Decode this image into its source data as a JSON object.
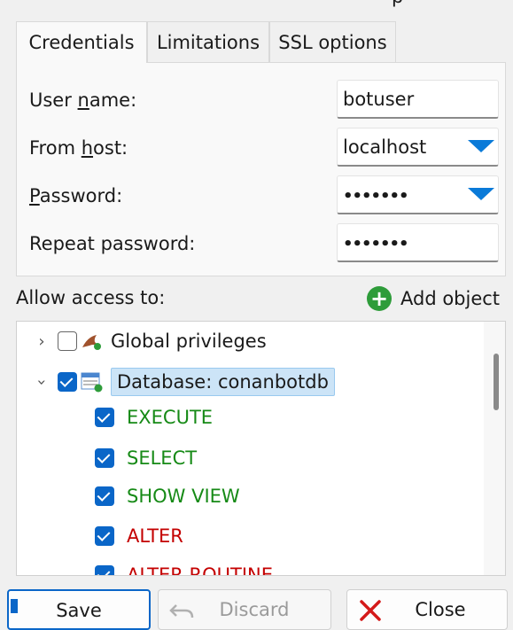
{
  "top_fragment": "p",
  "tabs": [
    {
      "label": "Credentials",
      "active": true
    },
    {
      "label": "Limitations",
      "active": false
    },
    {
      "label": "SSL options",
      "active": false
    }
  ],
  "fields": {
    "user_name": {
      "label_pre": "User ",
      "label_u": "n",
      "label_post": "ame:",
      "value": "botuser"
    },
    "from_host": {
      "label_pre": "From ",
      "label_u": "h",
      "label_post": "ost:",
      "value": "localhost"
    },
    "password": {
      "label_pre": "",
      "label_u": "P",
      "label_post": "assword:",
      "value": "•••••••"
    },
    "repeat_password": {
      "label": "Repeat password:",
      "value": "•••••••"
    }
  },
  "allow_access_label": "Allow access to:",
  "add_object_label": "Add object",
  "tree": {
    "global": "Global privileges",
    "database": "Database: conanbotdb",
    "privileges": [
      {
        "label": "EXECUTE",
        "color": "#168a16"
      },
      {
        "label": "SELECT",
        "color": "#168a16"
      },
      {
        "label": "SHOW VIEW",
        "color": "#168a16"
      },
      {
        "label": "ALTER",
        "color": "#c40000"
      },
      {
        "label": "ALTER ROUTINE",
        "color": "#c40000"
      }
    ]
  },
  "buttons": {
    "save": "Save",
    "discard": "Discard",
    "close": "Close"
  },
  "icons": [
    "dolphin-icon",
    "database-icon",
    "plus-icon",
    "undo-icon",
    "close-x-icon",
    "save-icon"
  ]
}
